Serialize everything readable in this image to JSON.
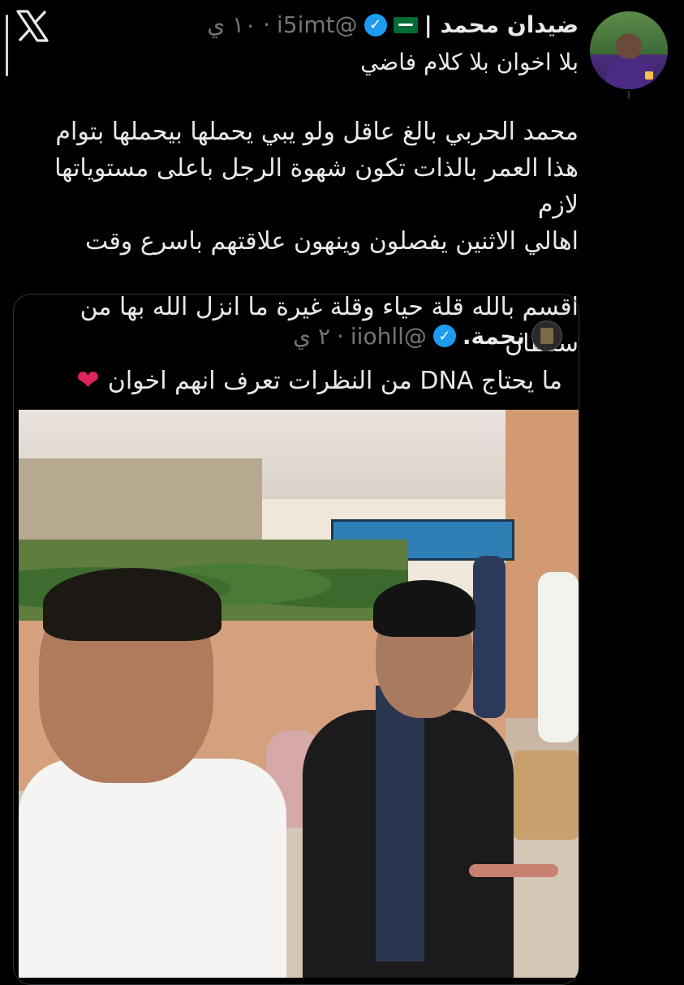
{
  "post": {
    "display_name": "ضيدان محمد |",
    "handle": "@i5imt",
    "separator": "·",
    "time": "١٠ ي",
    "subtitle": "بلا اخوان بلا كلام فاضي",
    "body_lines": [
      "محمد الحربي بالغ عاقل ولو يبي يحملها بيحملها بتوام",
      "هذا العمر بالذات تكون شهوة الرجل باعلى مستوياتها لازم",
      "اهالي الاثنين يفصلون وينهون علاقتهم باسرع وقت"
    ],
    "body_line_4": "اقسم بالله قلة حياء وقلة غيرة ما انزل الله بها من سلطان"
  },
  "quoted": {
    "display_name": "نجمة.",
    "handle": "@iiohll",
    "separator": "·",
    "time": "٢ ي",
    "text": "ما يحتاج DNA من النظرات تعرف انهم اخوان"
  },
  "icons": {
    "logo": "x-logo-icon",
    "verified": "verified-badge-icon",
    "flag": "saudi-flag-icon",
    "heart": "red-heart-icon"
  },
  "colors": {
    "background": "#000000",
    "text": "#e7e9ea",
    "muted": "#71767b",
    "verified": "#1d9bf0",
    "border": "#2f3336"
  }
}
